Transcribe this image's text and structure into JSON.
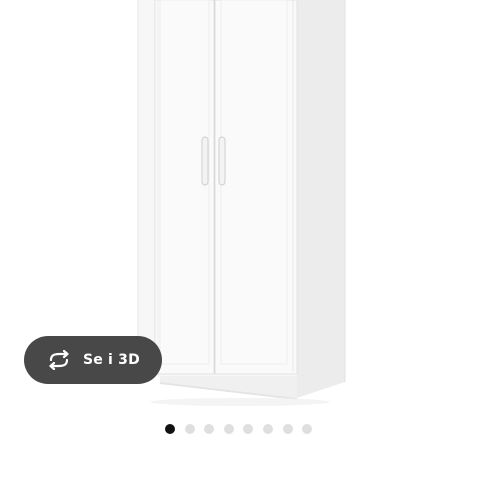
{
  "view3d": {
    "label": "Se i 3D",
    "icon": "rotate-360-icon"
  },
  "carousel": {
    "slide_count": 8,
    "active_index": 0
  },
  "colors": {
    "button_bg": "#484848",
    "dot_active": "#111111",
    "dot_inactive": "#dfdfdf"
  }
}
